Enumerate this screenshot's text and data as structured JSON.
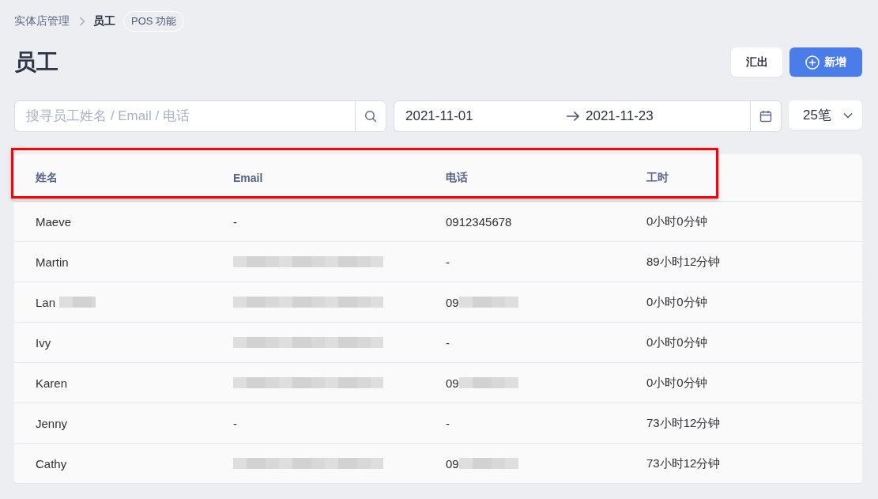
{
  "breadcrumb": {
    "items": [
      {
        "label": "实体店管理",
        "current": false
      },
      {
        "label": "员工",
        "current": true
      }
    ],
    "badge": "POS 功能"
  },
  "page_title": "员工",
  "actions": [
    {
      "label": "汇出",
      "kind": "secondary"
    },
    {
      "label": "新增",
      "kind": "primary"
    }
  ],
  "filters": {
    "search": {
      "placeholder": "搜寻员工姓名 / Email / 电话"
    },
    "date_range": {
      "start": "2021-11-01",
      "end": "2021-11-23"
    },
    "page_size": {
      "value": "25笔"
    }
  },
  "table": {
    "header_highlighted": true,
    "columns": [
      {
        "label": "姓名"
      },
      {
        "label": "Email"
      },
      {
        "label": "电话"
      },
      {
        "label": "工时"
      }
    ],
    "rows": [
      {
        "cells": [
          {
            "text": "Maeve",
            "redacted": false
          },
          {
            "text": "-",
            "redacted": false
          },
          {
            "text": "0912345678",
            "redacted": false
          },
          {
            "text": "0小时0分钟",
            "redacted": false
          }
        ]
      },
      {
        "cells": [
          {
            "text": "Martin",
            "redacted": false
          },
          {
            "redacted": true
          },
          {
            "text": "-",
            "redacted": false
          },
          {
            "text": "89小时12分钟",
            "redacted": false
          }
        ]
      },
      {
        "cells": [
          {
            "text": "Lan",
            "redacted": true
          },
          {
            "redacted": true
          },
          {
            "text": "09",
            "redacted": true
          },
          {
            "text": "0小时0分钟",
            "redacted": false
          }
        ]
      },
      {
        "cells": [
          {
            "text": "Ivy",
            "redacted": false
          },
          {
            "redacted": true
          },
          {
            "text": "-",
            "redacted": false
          },
          {
            "text": "0小时0分钟",
            "redacted": false
          }
        ]
      },
      {
        "cells": [
          {
            "text": "Karen",
            "redacted": false
          },
          {
            "redacted": true
          },
          {
            "text": "09",
            "redacted": true
          },
          {
            "text": "0小时0分钟",
            "redacted": false
          }
        ]
      },
      {
        "cells": [
          {
            "text": "Jenny",
            "redacted": false
          },
          {
            "text": "-",
            "redacted": false
          },
          {
            "text": "-",
            "redacted": false
          },
          {
            "text": "73小时12分钟",
            "redacted": false
          }
        ]
      },
      {
        "cells": [
          {
            "text": "Cathy",
            "redacted": false
          },
          {
            "redacted": true
          },
          {
            "text": "09",
            "redacted": true
          },
          {
            "text": "73小时12分钟",
            "redacted": false
          }
        ]
      }
    ]
  }
}
